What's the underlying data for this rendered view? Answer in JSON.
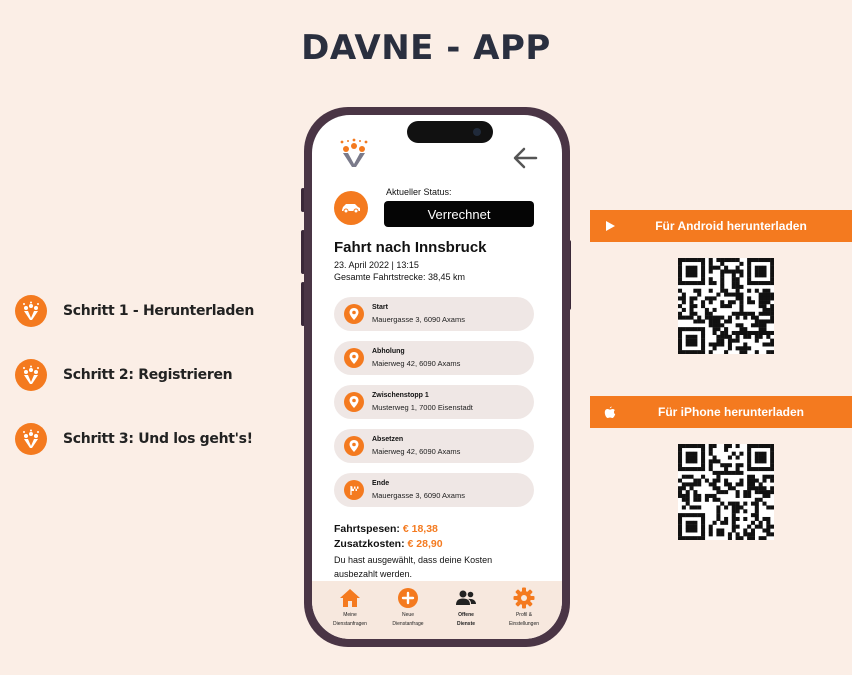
{
  "page": {
    "title": "DAVNE - APP"
  },
  "steps": [
    {
      "label": "Schritt 1 - Herunterladen"
    },
    {
      "label": "Schritt 2: Registrieren"
    },
    {
      "label": "Schritt 3: Und los geht's!"
    }
  ],
  "downloads": {
    "android_label": "Für Android herunterladen",
    "iphone_label": "Für iPhone herunterladen"
  },
  "app": {
    "status_caption": "Aktueller Status:",
    "status_value": "Verrechnet",
    "trip_title": "Fahrt nach Innsbruck",
    "trip_date": "23. April 2022 | 13:15",
    "trip_distance": "Gesamte Fahrtstrecke: 38,45 km",
    "stops": [
      {
        "name": "Start",
        "address": "Mauergasse 3, 6090 Axams",
        "icon": "pin-icon"
      },
      {
        "name": "Abholung",
        "address": "Maierweg 42, 6090 Axams",
        "icon": "pin-icon"
      },
      {
        "name": "Zwischenstopp 1",
        "address": "Musterweg 1, 7000 Eisenstadt",
        "icon": "pin-icon"
      },
      {
        "name": "Absetzen",
        "address": "Maierweg 42, 6090 Axams",
        "icon": "pin-icon"
      },
      {
        "name": "Ende",
        "address": "Mauergasse 3, 6090 Axams",
        "icon": "flag-icon"
      }
    ],
    "costs": {
      "fahrtspesen_label": "Fahrtspesen:",
      "fahrtspesen_value": "€ 18,38",
      "zusatz_label": "Zusatzkosten:",
      "zusatz_value": "€ 28,90"
    },
    "note": "Du hast ausgewählt, dass deine Kosten ausbezahlt werden.",
    "tabs": [
      {
        "line1": "Meine",
        "line2": "Dienstanfragen",
        "icon": "home-icon"
      },
      {
        "line1": "Neue",
        "line2": "Dienstanfrage",
        "icon": "plus-icon"
      },
      {
        "line1": "Offene",
        "line2": "Dienste",
        "icon": "people-icon"
      },
      {
        "line1": "Profil &",
        "line2": "Einstellungen",
        "icon": "gear-icon"
      }
    ]
  },
  "colors": {
    "accent": "#f47a1f",
    "background": "#fbeee6",
    "phone_frame": "#4a3545"
  }
}
